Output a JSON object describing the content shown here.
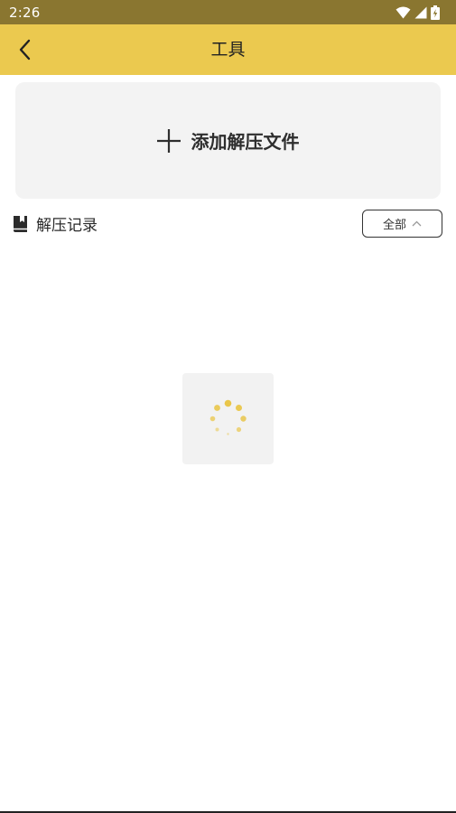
{
  "status_bar": {
    "time": "2:26"
  },
  "app_bar": {
    "title": "工具",
    "back_icon": "chevron-left-icon"
  },
  "add_card": {
    "label": "添加解压文件",
    "icon": "plus-icon"
  },
  "records": {
    "title": "解压记录",
    "icon": "bookmark-book-icon",
    "filter_label": "全部",
    "filter_icon": "chevron-up-icon"
  },
  "colors": {
    "status_bar": "#8a7630",
    "app_bar": "#ebc94f",
    "accent": "#e9c64a",
    "card_bg": "#f3f3f3"
  }
}
